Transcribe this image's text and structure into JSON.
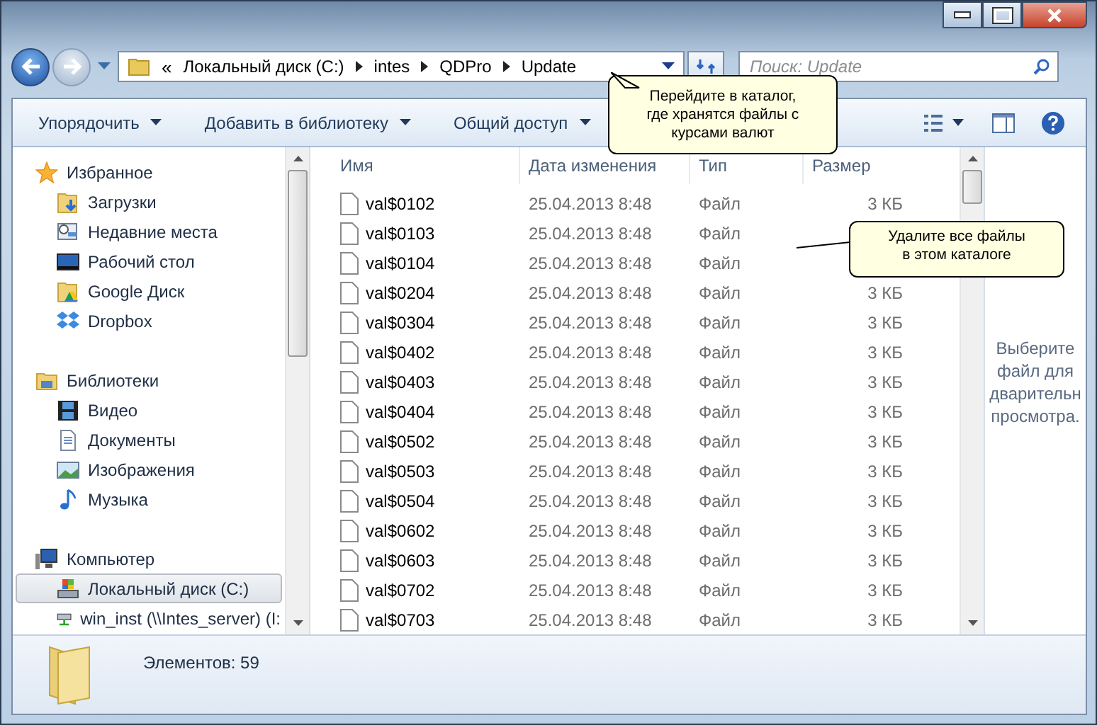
{
  "address_bar": {
    "overflow": "«",
    "crumbs": [
      "Локальный диск (C:)",
      "intes",
      "QDPro",
      "Update"
    ]
  },
  "search": {
    "placeholder": "Поиск: Update"
  },
  "toolbar": {
    "buttons": [
      "Упорядочить",
      "Добавить в библиотеку",
      "Общий доступ"
    ]
  },
  "sidebar": {
    "groups": [
      {
        "label": "Избранное",
        "children": [
          {
            "label": "Загрузки",
            "selected": false
          },
          {
            "label": "Недавние места",
            "selected": false
          },
          {
            "label": "Рабочий стол",
            "selected": false
          },
          {
            "label": "Google Диск",
            "selected": false
          },
          {
            "label": "Dropbox",
            "selected": false
          }
        ]
      },
      {
        "label": "Библиотеки",
        "children": [
          {
            "label": "Видео",
            "selected": false
          },
          {
            "label": "Документы",
            "selected": false
          },
          {
            "label": "Изображения",
            "selected": false
          },
          {
            "label": "Музыка",
            "selected": false
          }
        ]
      },
      {
        "label": "Компьютер",
        "children": [
          {
            "label": "Локальный диск (C:)",
            "selected": true
          },
          {
            "label": "win_inst (\\\\Intes_server) (I:",
            "selected": false
          }
        ]
      }
    ]
  },
  "table": {
    "columns": [
      "Имя",
      "Дата изменения",
      "Тип",
      "Размер"
    ],
    "rows": [
      {
        "name": "val$0102",
        "date": "25.04.2013 8:48",
        "type": "Файл",
        "size": "3 КБ"
      },
      {
        "name": "val$0103",
        "date": "25.04.2013 8:48",
        "type": "Файл"
      },
      {
        "name": "val$0104",
        "date": "25.04.2013 8:48",
        "type": "Файл"
      },
      {
        "name": "val$0204",
        "date": "25.04.2013 8:48",
        "type": "Файл",
        "size": "3 КБ"
      },
      {
        "name": "val$0304",
        "date": "25.04.2013 8:48",
        "type": "Файл",
        "size": "3 КБ"
      },
      {
        "name": "val$0402",
        "date": "25.04.2013 8:48",
        "type": "Файл",
        "size": "3 КБ"
      },
      {
        "name": "val$0403",
        "date": "25.04.2013 8:48",
        "type": "Файл",
        "size": "3 КБ"
      },
      {
        "name": "val$0404",
        "date": "25.04.2013 8:48",
        "type": "Файл",
        "size": "3 КБ"
      },
      {
        "name": "val$0502",
        "date": "25.04.2013 8:48",
        "type": "Файл",
        "size": "3 КБ"
      },
      {
        "name": "val$0503",
        "date": "25.04.2013 8:48",
        "type": "Файл",
        "size": "3 КБ"
      },
      {
        "name": "val$0504",
        "date": "25.04.2013 8:48",
        "type": "Файл",
        "size": "3 КБ"
      },
      {
        "name": "val$0602",
        "date": "25.04.2013 8:48",
        "type": "Файл",
        "size": "3 КБ"
      },
      {
        "name": "val$0603",
        "date": "25.04.2013 8:48",
        "type": "Файл",
        "size": "3 КБ"
      },
      {
        "name": "val$0702",
        "date": "25.04.2013 8:48",
        "type": "Файл",
        "size": "3 КБ"
      },
      {
        "name": "val$0703",
        "date": "25.04.2013 8:48",
        "type": "Файл",
        "size": "3 КБ"
      }
    ]
  },
  "preview": {
    "lines": [
      "Выберите",
      "файл для",
      "дварительн",
      "просмотра."
    ]
  },
  "callouts": [
    {
      "text": "Перейдите в каталог, где хранятся файлы с курсами валют"
    },
    {
      "text": "Удалите все файлы в этом каталоге"
    }
  ],
  "status_bar": {
    "text": "Элементов: 59"
  }
}
